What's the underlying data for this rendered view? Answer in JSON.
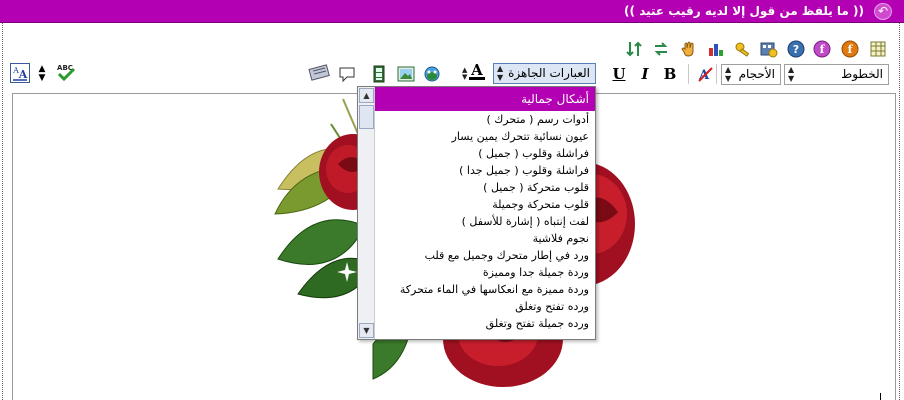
{
  "title_bar": {
    "title": "(( ما يلفظ من قول إلا لديه رقيب عتيد ))",
    "collapse_icon": "collapse-arrow-icon",
    "background": "#b200b2"
  },
  "toolbar_top": {
    "icons": [
      "table-icon",
      "flash-icon",
      "flash-alt-icon",
      "help-icon",
      "media-icon",
      "key-icon",
      "chart-icon",
      "hand-icon",
      "swap-direction-icon",
      "sort-icon"
    ]
  },
  "toolbar_bottom": {
    "fonts_label": "الخطوط",
    "sizes_label": "الأحجام",
    "phrases_label": "العبارات الجاهزة",
    "icons": [
      "spellcheck-icon",
      "resize-icon",
      "text-size-icon",
      "remove-format-icon",
      "bold-icon",
      "italic-icon",
      "underline-icon",
      "font-color-icon",
      "add-emoticon-icon",
      "insert-image-icon",
      "insert-video-icon",
      "comment-icon",
      "keyboard-icon"
    ],
    "bold": "B",
    "italic": "I",
    "underline": "U",
    "text_color": "A",
    "remove_format": "A",
    "spellcheck_label": "ABC",
    "size_toggle_label": "A"
  },
  "dropdown": {
    "selected": "أشكال جمالية",
    "items": [
      "أدوات رسم ( متحرك )",
      "عيون نسائية تتحرك يمين يسار",
      "فراشلة وقلوب ( جميل )",
      "فراشلة وقلوب ( جميل جدا )",
      "قلوب متحركة ( جميل )",
      "قلوب متحركة وجميلة",
      "لفت إنتباه ( إشارة للأسفل )",
      "نجوم فلاشية",
      "ورد في إطار متحرك وجميل مع قلب",
      "وردة جميلة جدا ومميزة",
      "وردة مميزة مع انعكاسها في الماء متحركة",
      "ورده تفتح وتغلق",
      "ورده جميلة تفتح وتغلق"
    ],
    "scroll_up_icon": "scroll-up-icon",
    "scroll_down_icon": "scroll-down-icon",
    "accent": "#b200b2"
  },
  "editor": {
    "image": "red-roses-image"
  }
}
